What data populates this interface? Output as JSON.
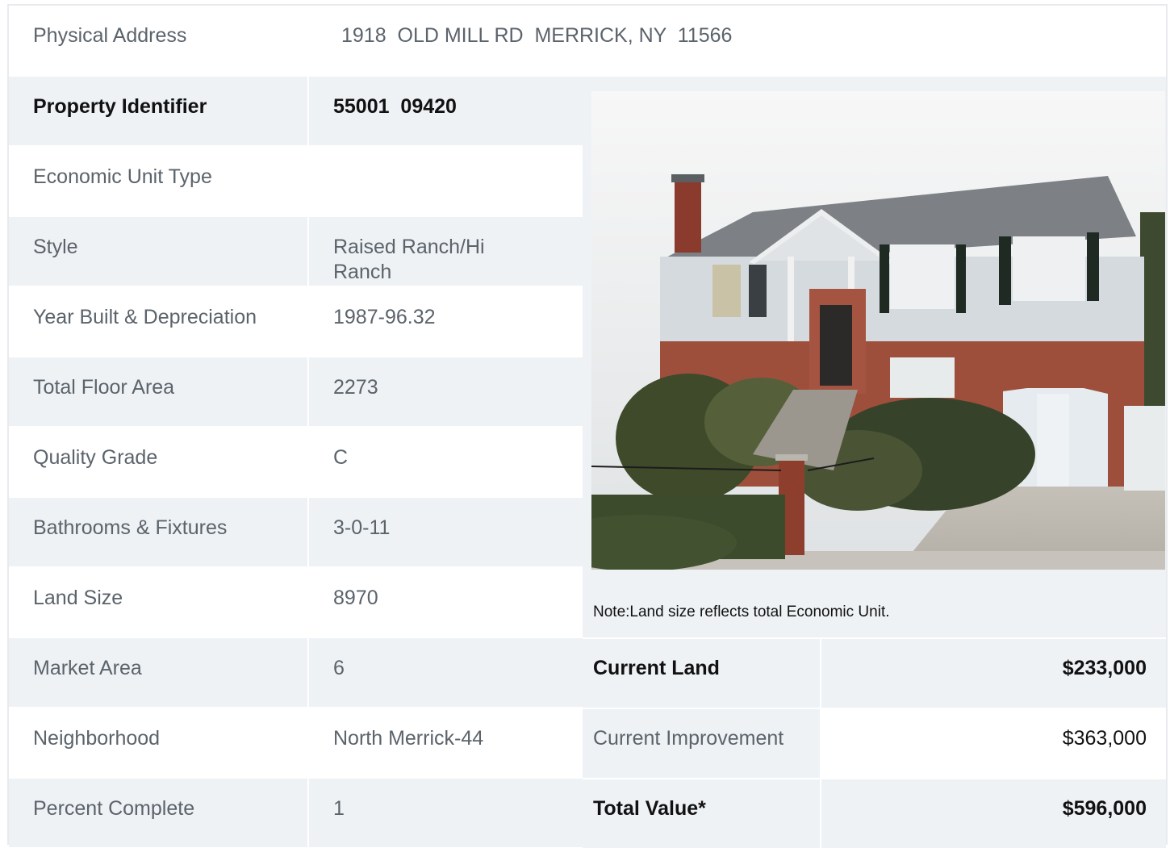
{
  "address": {
    "label": "Physical Address",
    "value": "1918  OLD MILL RD  MERRICK, NY  11566"
  },
  "property_rows": [
    {
      "label": "Property Identifier",
      "value": "55001  09420",
      "bold": true
    },
    {
      "label": "Economic Unit Type",
      "value": ""
    },
    {
      "label": "Style",
      "value": "Raised Ranch/Hi Ranch"
    },
    {
      "label": "Year Built & Depreciation",
      "value": "1987-96.32"
    },
    {
      "label": "Total Floor Area",
      "value": "2273"
    },
    {
      "label": "Quality Grade",
      "value": "C"
    },
    {
      "label": "Bathrooms & Fixtures",
      "value": "3-0-11"
    },
    {
      "label": "Land Size",
      "value": "8970"
    },
    {
      "label": "Market Area",
      "value": "6"
    },
    {
      "label": "Neighborhood",
      "value": "North Merrick-44"
    },
    {
      "label": "Percent Complete",
      "value": "1"
    }
  ],
  "note": "Note:Land size reflects total Economic Unit.",
  "valuation": [
    {
      "label": "Current Land",
      "value": "$233,000",
      "bold": true
    },
    {
      "label": "Current Improvement",
      "value": "$363,000",
      "bold": false
    },
    {
      "label": "Total Value*",
      "value": "$596,000",
      "bold": true
    }
  ]
}
